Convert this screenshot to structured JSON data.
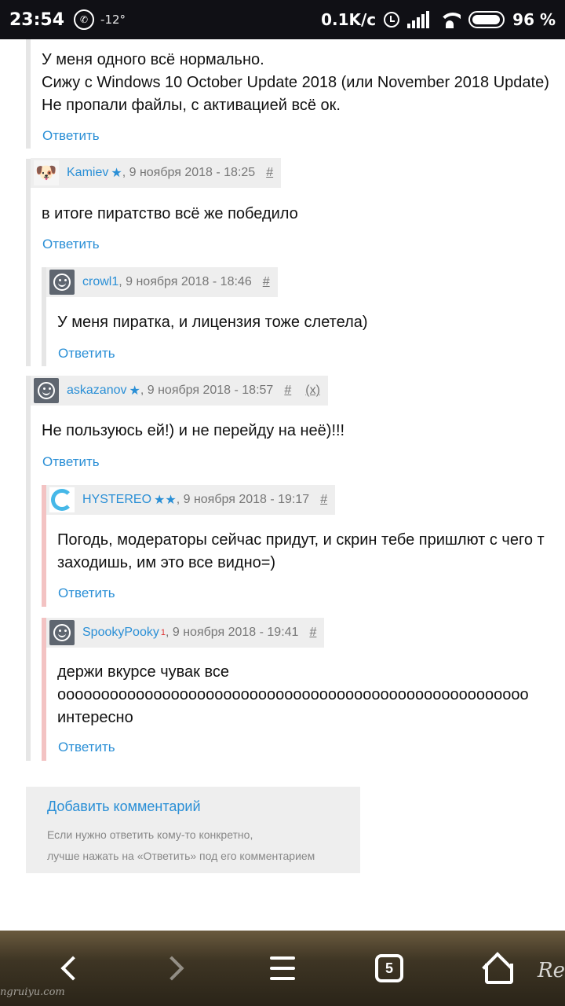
{
  "status_bar": {
    "time": "23:54",
    "temperature": "-12°",
    "speed": "0.1K/c",
    "battery_pct": "96 %",
    "battery_level": 0.96
  },
  "reply_label": "Ответить",
  "hash_label": "#",
  "top_comment": {
    "lines": [
      "У меня одного всё нормально.",
      "Сижу с Windows 10 October Update 2018 (или November 2018 Update)",
      "Не пропали файлы, с активацией всё ок."
    ]
  },
  "comments": [
    {
      "user": "Kamiev",
      "stars": "★",
      "date": ", 9 ноября 2018 - 18:25",
      "lines": [
        "в итоге пиратство всё же победило"
      ]
    },
    {
      "user": "crowl1",
      "stars": "",
      "date": ", 9 ноября 2018 - 18:46",
      "lines": [
        "У меня пиратка, и лицензия тоже слетела)"
      ]
    },
    {
      "user": "askazanov",
      "stars": "★",
      "date": ", 9 ноября 2018 - 18:57",
      "extra": "(x)",
      "lines": [
        "Не пользуюсь ей!) и не перейду на неё)!!!"
      ]
    },
    {
      "user": "HYSTEREO",
      "stars": "★★",
      "date": ", 9 ноября 2018 - 19:17",
      "lines": [
        "Погодь, модераторы сейчас придут, и скрин тебе пришлют с чего т",
        "заходишь, им это все видно=)"
      ]
    },
    {
      "user": "SpookyPooky",
      "sup": "1",
      "date": ", 9 ноября 2018 - 19:41",
      "lines": [
        "держи вкурсе чувак все",
        "оооооооооооооооооооооооооооооооооооооооооооооооооооооо",
        "интересно"
      ]
    }
  ],
  "add_comment": {
    "title": "Добавить комментарий",
    "hint_line1": "Если нужно ответить кому-то конкретно,",
    "hint_line2": "лучше нажать на «Ответить» под его комментарием"
  },
  "bottom_nav": {
    "tabs_count": "5",
    "brand_partial": "Re",
    "watermark": "ngruiyu.com"
  }
}
